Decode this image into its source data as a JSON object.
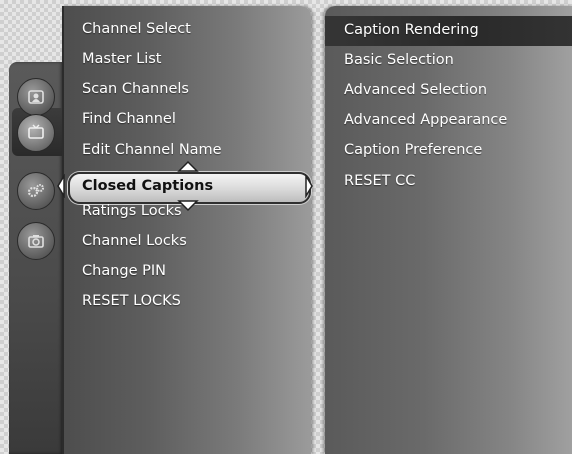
{
  "categories": [
    {
      "icon": "parental-icon",
      "active": false
    },
    {
      "icon": "tv-icon",
      "active": true
    },
    {
      "icon": "gears-icon",
      "active": false
    },
    {
      "icon": "camera-icon",
      "active": false
    }
  ],
  "main_menu": {
    "items": [
      {
        "label": "Channel Select"
      },
      {
        "label": "Master List"
      },
      {
        "label": "Scan Channels"
      },
      {
        "label": "Find Channel"
      },
      {
        "label": "Edit Channel Name"
      },
      {
        "label": "Closed Captions",
        "selected": true
      },
      {
        "label": "Ratings Locks"
      },
      {
        "label": "Channel Locks"
      },
      {
        "label": "Change PIN"
      },
      {
        "label": "RESET LOCKS"
      }
    ]
  },
  "sub_menu": {
    "items": [
      {
        "label": "Caption Rendering",
        "highlighted": true
      },
      {
        "label": "Basic Selection"
      },
      {
        "label": "Advanced Selection"
      },
      {
        "label": "Advanced Appearance"
      },
      {
        "label": "Caption Preference"
      },
      {
        "label": "RESET CC"
      }
    ]
  },
  "colors": {
    "selection_fill": "#d9d9d9",
    "menu_text": "#ffffff",
    "selected_text": "#111111"
  }
}
